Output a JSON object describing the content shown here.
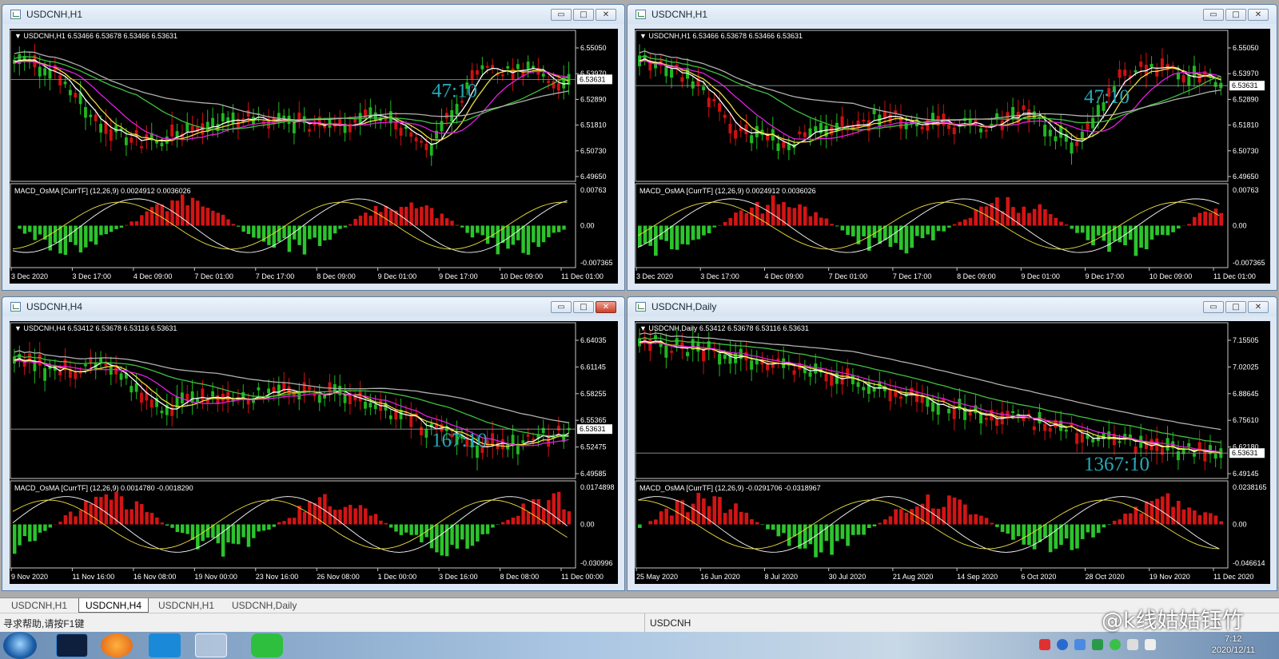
{
  "windows": [
    {
      "id": "h1-left",
      "title": "USDCNH,H1",
      "info": "USDCNH,H1  6.53466 6.53678 6.53466 6.53631",
      "price_labels": [
        "6.55050",
        "6.53970",
        "6.52890",
        "6.51810",
        "6.50730",
        "6.49650"
      ],
      "current_price": "6.53631",
      "countdown": "47:10",
      "macd_info": "MACD_OsMA [CurrTF] (12,26,9) 0.0024912 0.0036026",
      "macd_labels": [
        "0.00763",
        "0.00",
        "-0.007365"
      ],
      "time_labels": [
        "3 Dec 2020",
        "3 Dec 17:00",
        "4 Dec 09:00",
        "7 Dec 01:00",
        "7 Dec 17:00",
        "8 Dec 09:00",
        "9 Dec 01:00",
        "9 Dec 17:00",
        "10 Dec 09:00",
        "11 Dec 01:00"
      ],
      "close_red": false
    },
    {
      "id": "h1-right",
      "title": "USDCNH,H1",
      "info": "USDCNH,H1  6.53466 6.53678 6.53466 6.53631",
      "price_labels": [
        "6.55050",
        "6.53970",
        "6.52890",
        "6.51810",
        "6.50730",
        "6.49650"
      ],
      "current_price": "6.53631",
      "countdown": "47:10",
      "macd_info": "MACD_OsMA [CurrTF] (12,26,9) 0.0024912 0.0036026",
      "macd_labels": [
        "0.00763",
        "0.00",
        "-0.007365"
      ],
      "time_labels": [
        "3 Dec 2020",
        "3 Dec 17:00",
        "4 Dec 09:00",
        "7 Dec 01:00",
        "7 Dec 17:00",
        "8 Dec 09:00",
        "9 Dec 01:00",
        "9 Dec 17:00",
        "10 Dec 09:00",
        "11 Dec 01:00"
      ],
      "close_red": false
    },
    {
      "id": "h4-left",
      "title": "USDCNH,H4",
      "info": "USDCNH,H4  6.53412 6.53678 6.53116 6.53631",
      "price_labels": [
        "6.64035",
        "6.61145",
        "6.58255",
        "6.55365",
        "6.52475",
        "6.49585"
      ],
      "current_price": "6.53631",
      "countdown": "167:10",
      "macd_info": "MACD_OsMA [CurrTF] (12,26,9) 0.0014780 -0.0018290",
      "macd_labels": [
        "0.0174898",
        "0.00",
        "-0.030996"
      ],
      "time_labels": [
        "9 Nov 2020",
        "11 Nov 16:00",
        "16 Nov 08:00",
        "19 Nov 00:00",
        "23 Nov 16:00",
        "26 Nov 08:00",
        "1 Dec 00:00",
        "3 Dec 16:00",
        "8 Dec 08:00",
        "11 Dec 00:00"
      ],
      "close_red": true
    },
    {
      "id": "daily-right",
      "title": "USDCNH,Daily",
      "info": "USDCNH,Daily  6.53412 6.53678 6.53116 6.53631",
      "price_labels": [
        "7.15505",
        "7.02025",
        "6.88645",
        "6.75610",
        "6.62180",
        "6.49145"
      ],
      "current_price": "6.53631",
      "countdown": "1367:10",
      "macd_info": "MACD_OsMA [CurrTF] (12,26,9) -0.0291706 -0.0318967",
      "macd_labels": [
        "0.0238165",
        "0.00",
        "-0.046614"
      ],
      "time_labels": [
        "25 May 2020",
        "16 Jun 2020",
        "8 Jul 2020",
        "30 Jul 2020",
        "21 Aug 2020",
        "14 Sep 2020",
        "6 Oct 2020",
        "28 Oct 2020",
        "19 Nov 2020",
        "11 Dec 2020"
      ],
      "close_red": false
    }
  ],
  "window_buttons": {
    "minimize": "▭",
    "maximize": "□",
    "close": "✕"
  },
  "tabs": [
    "USDCNH,H1",
    "USDCNH,H4",
    "USDCNH,H1",
    "USDCNH,Daily"
  ],
  "active_tab": 1,
  "status": {
    "help": "寻求帮助,请按F1键",
    "symbol": "USDCNH"
  },
  "watermark": "@k线姑姑钰竹",
  "clock": {
    "time": "7:12",
    "date": "2020/12/11"
  },
  "colors": {
    "bull": "#1fb81f",
    "bear": "#d01010",
    "ma_fast": "#ffffff",
    "ma_yellow": "#f0e040",
    "ma_magenta": "#e020e0",
    "ma_green": "#40c040",
    "ma_gray": "#b0b0b0",
    "countdown": "#27a8b8"
  }
}
